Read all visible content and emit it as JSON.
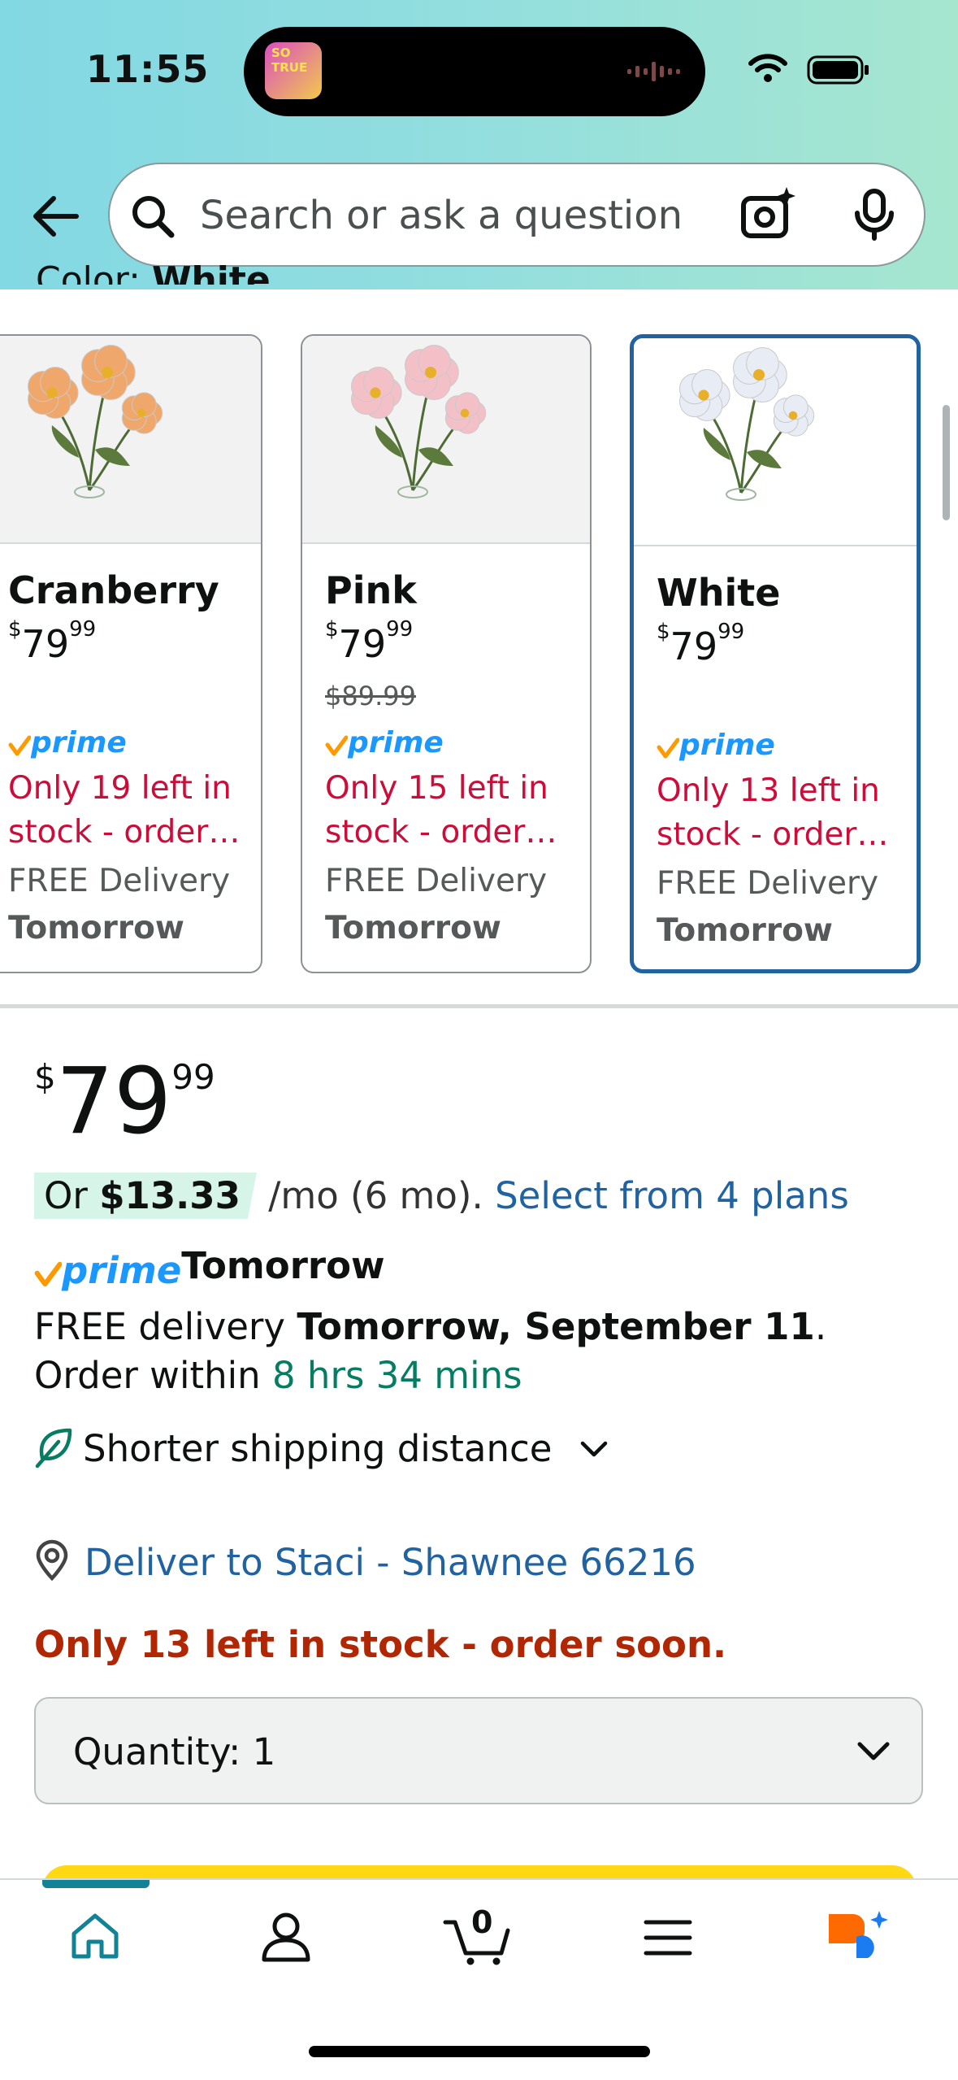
{
  "status_bar": {
    "time": "11:55",
    "island_thumb_text": "SO TRUE"
  },
  "search": {
    "placeholder": "Search or ask a question"
  },
  "variation": {
    "label": "Color:",
    "value": "White"
  },
  "swatches": [
    {
      "name": "Cranberry",
      "dollars": "79",
      "cents": "99",
      "currency": "$",
      "list_price": "",
      "prime": "prime",
      "stock": "Only 19 left in stock - order…",
      "delivery": "FREE Delivery",
      "day": "Tomorrow",
      "selected": false,
      "petal_color": "#f0a76b"
    },
    {
      "name": "Pink",
      "dollars": "79",
      "cents": "99",
      "currency": "$",
      "list_price": "$89.99",
      "prime": "prime",
      "stock": "Only 15 left in stock - order…",
      "delivery": "FREE Delivery",
      "day": "Tomorrow",
      "selected": false,
      "petal_color": "#f4c0c8"
    },
    {
      "name": "White",
      "dollars": "79",
      "cents": "99",
      "currency": "$",
      "list_price": "",
      "prime": "prime",
      "stock": "Only 13 left in stock - order…",
      "delivery": "FREE Delivery",
      "day": "Tomorrow",
      "selected": true,
      "petal_color": "#e8ecf4"
    }
  ],
  "price": {
    "currency": "$",
    "dollars": "79",
    "cents": "99"
  },
  "installments": {
    "prefix": "Or ",
    "amount": "$13.33",
    "suffix": " /mo (6 mo). ",
    "link": "Select from 4 plans"
  },
  "prime_delivery": {
    "brand": "prime",
    "day": "Tomorrow"
  },
  "delivery": {
    "prefix": "FREE delivery ",
    "date": "Tomorrow, September 11",
    "mid": ". Order within ",
    "countdown": "8 hrs 34 mins"
  },
  "shipping_note": "Shorter shipping distance",
  "deliver_to": "Deliver to Staci - Shawnee 66216",
  "stock_status": "Only 13 left in stock - order soon.",
  "quantity": {
    "label": "Quantity:",
    "value": "1"
  },
  "tabbar": {
    "cart_count": "0",
    "active": "home"
  },
  "colors": {
    "accent": "#2162a1",
    "stock_red": "#b12704",
    "green": "#067d62",
    "teal": "#128296",
    "prime_blue": "#1a98ff",
    "prime_orange": "#ff9900"
  }
}
